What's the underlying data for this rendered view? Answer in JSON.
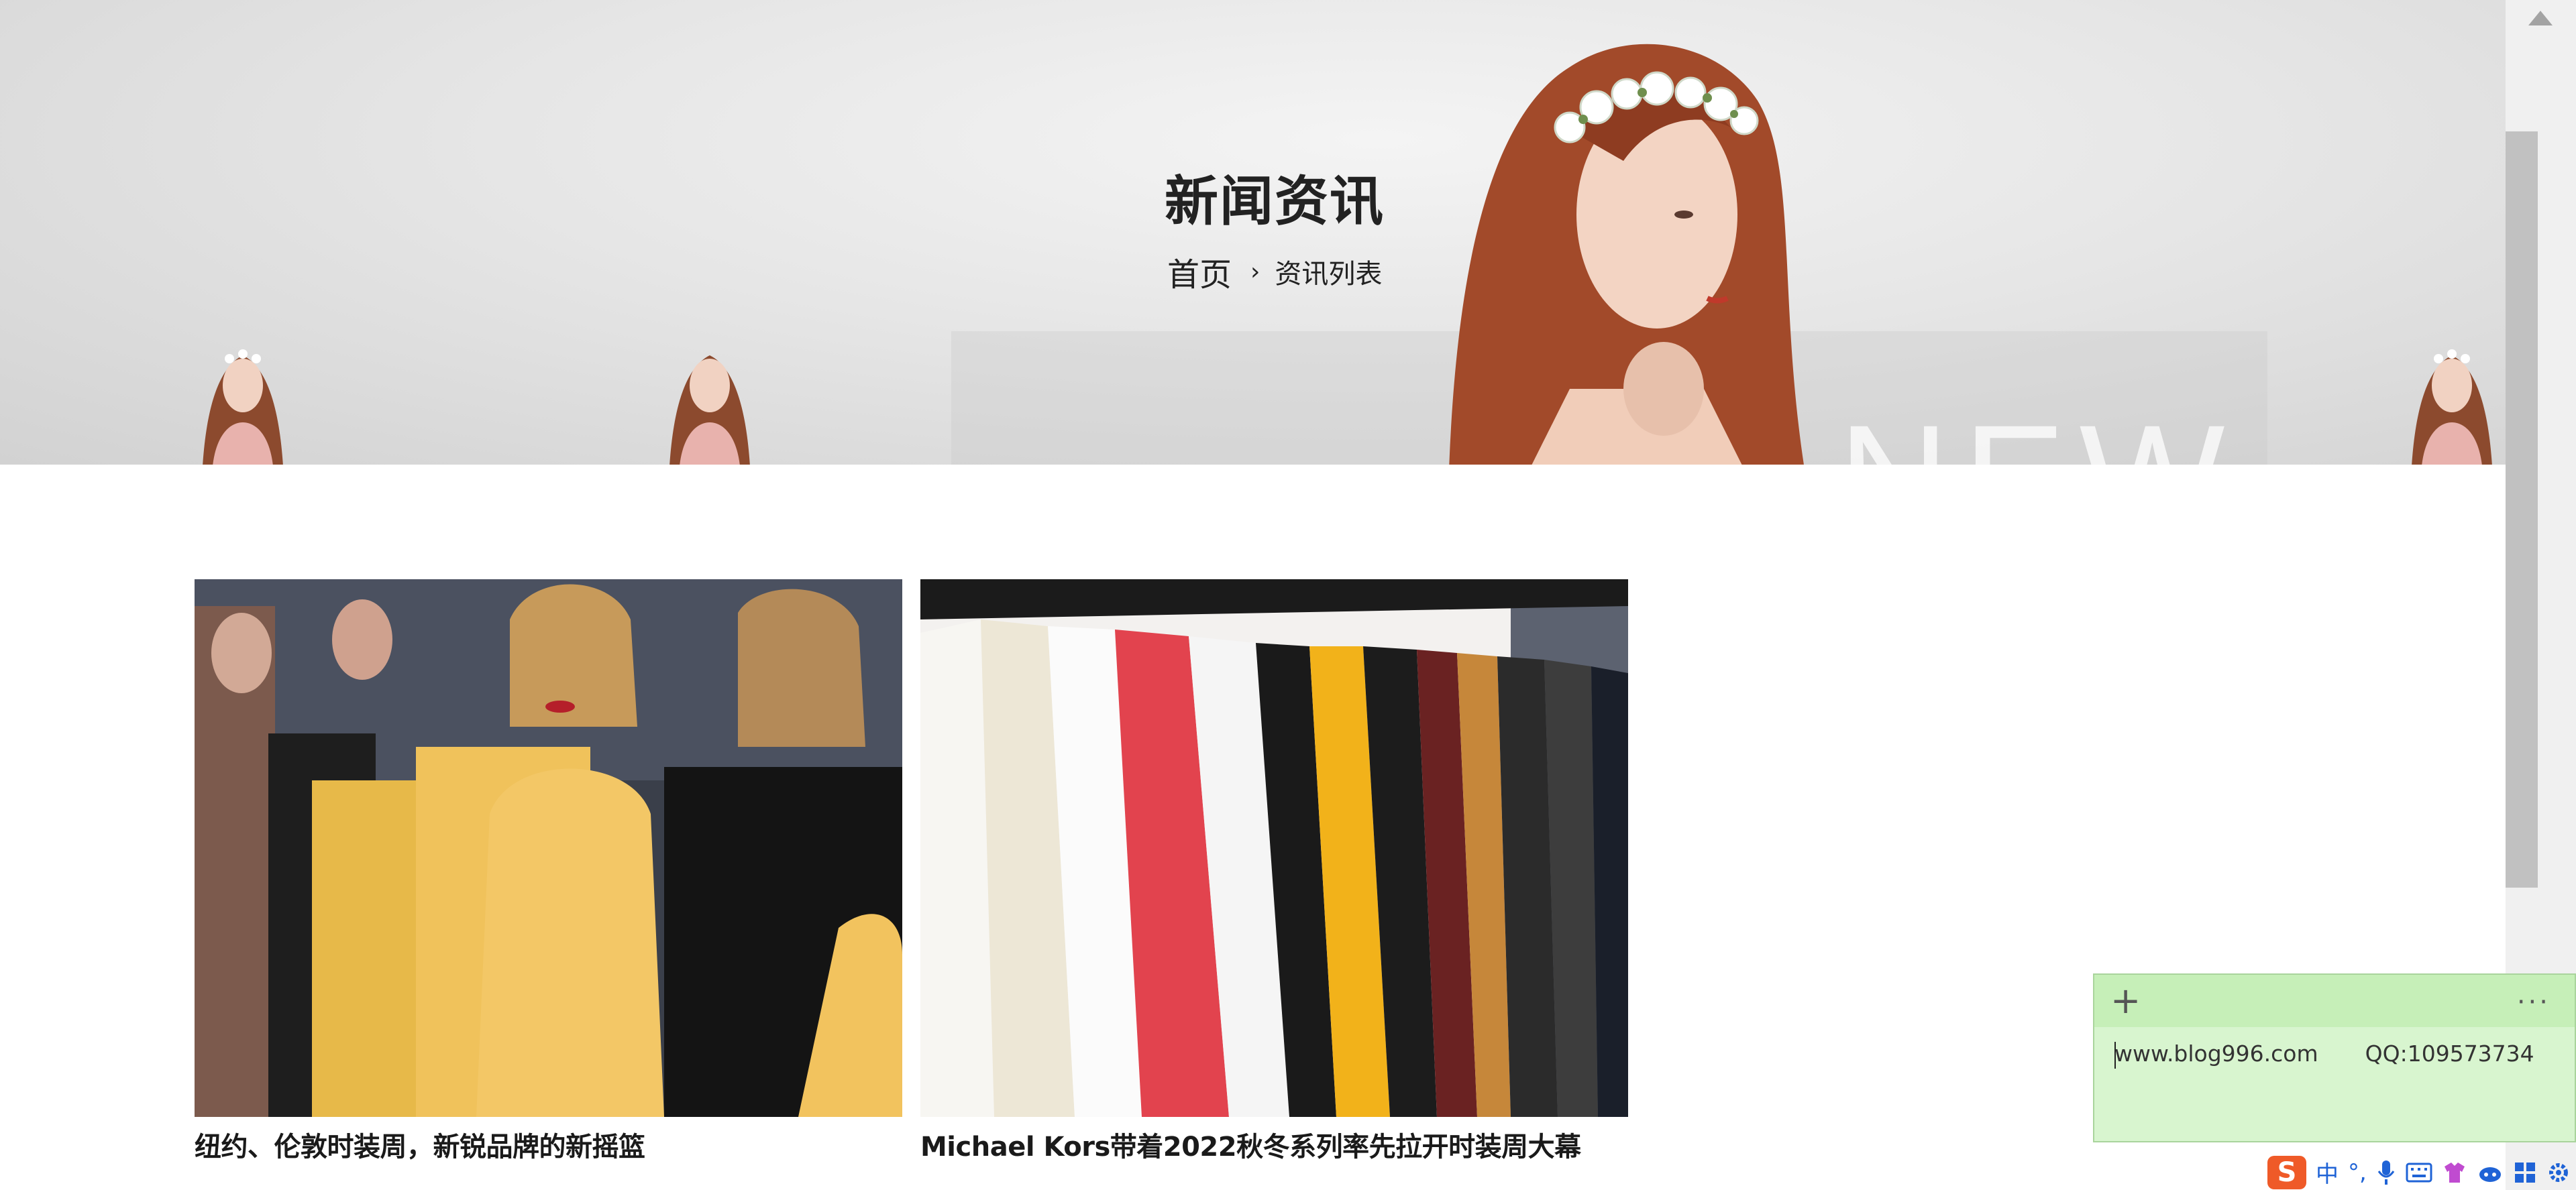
{
  "hero": {
    "title": "新闻资讯",
    "watermark": "NEW",
    "breadcrumb": {
      "home": "首页",
      "separator": "›",
      "current": "资讯列表"
    }
  },
  "news": [
    {
      "title": "纽约、伦敦时装周，新锐品牌的新摇篮",
      "image": "runway-models-yellow-dresses"
    },
    {
      "title": "Michael Kors带着2022秋冬系列率先拉开时装周大幕",
      "image": "clothes-rack-tshirts"
    }
  ],
  "sticky_note": {
    "add_icon": "plus-icon",
    "more_label": "···",
    "text_site": "www.blog996.com",
    "text_qq": "QQ:109573734"
  },
  "ime": {
    "logo": "S",
    "mode": "中",
    "punct": "°,",
    "icons": [
      "mic-icon",
      "keyboard-icon",
      "skin-icon",
      "cloud-icon",
      "apps-icon",
      "settings-icon"
    ]
  },
  "colors": {
    "note_bg": "#d8f5cf",
    "note_bar": "#c6efb8",
    "ime_logo": "#ef5a28",
    "ime_blue": "#1f63d6"
  }
}
